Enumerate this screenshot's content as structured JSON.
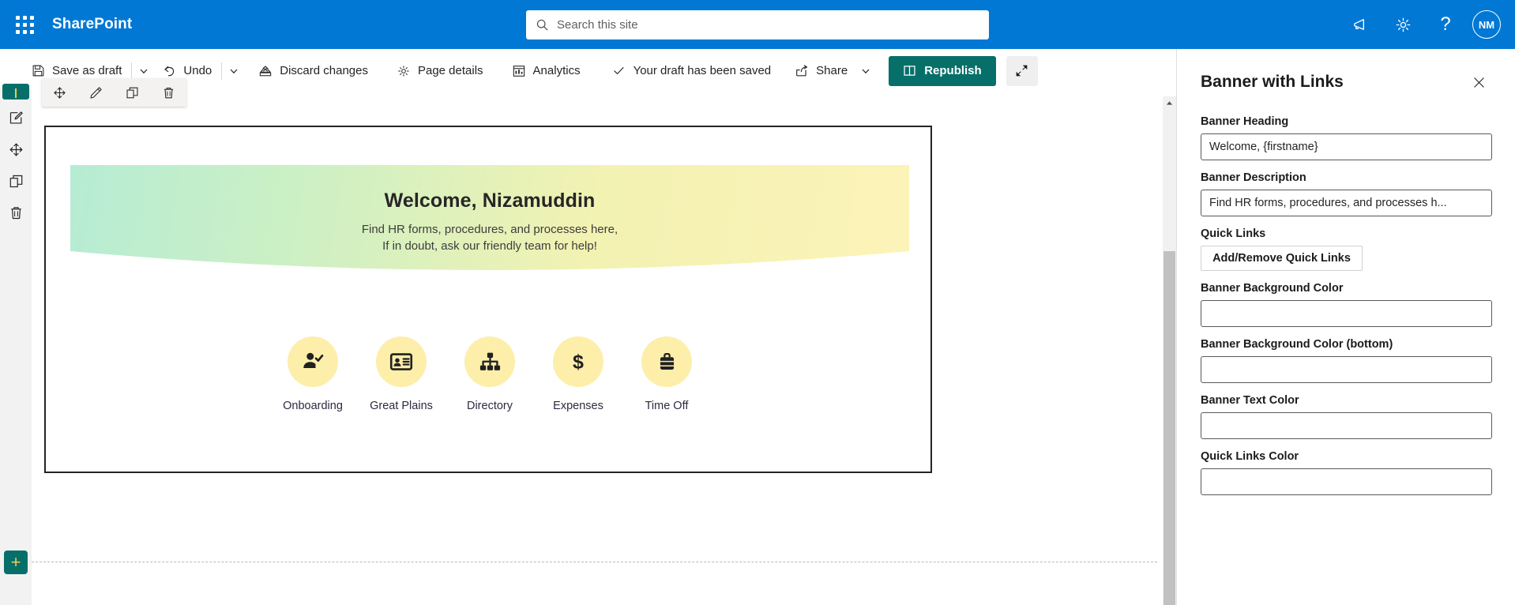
{
  "suite": {
    "brand": "SharePoint",
    "waffle_name": "app-launcher",
    "search_placeholder": "Search this site",
    "search_value": "",
    "icons": [
      {
        "name": "megaphone-icon",
        "glyph": "megaphone"
      },
      {
        "name": "gear-icon",
        "glyph": "gear"
      },
      {
        "name": "help-icon",
        "glyph": "?"
      }
    ],
    "avatar_initials": "NM"
  },
  "command_bar": {
    "save_as_draft": "Save as draft",
    "undo": "Undo",
    "discard_changes": "Discard changes",
    "page_details": "Page details",
    "analytics": "Analytics",
    "status_text": "Your draft has been saved",
    "share": "Share",
    "republish": "Republish",
    "collapse_name": "collapse-ribbon"
  },
  "left_rail": {
    "items": [
      {
        "name": "rail-edit-webpart",
        "icon": "edit-icon"
      },
      {
        "name": "rail-move-webpart",
        "icon": "move-icon"
      },
      {
        "name": "rail-duplicate-webpart",
        "icon": "duplicate-icon"
      },
      {
        "name": "rail-delete-webpart",
        "icon": "trash-icon"
      }
    ],
    "add_section_label": "+"
  },
  "webpart_toolbar": {
    "tools": [
      {
        "name": "move-webpart-button",
        "icon": "move-icon"
      },
      {
        "name": "edit-webpart-button",
        "icon": "pencil-icon"
      },
      {
        "name": "duplicate-webpart-button",
        "icon": "duplicate-icon"
      },
      {
        "name": "delete-webpart-button",
        "icon": "trash-icon"
      }
    ]
  },
  "banner": {
    "heading": "Welcome, Nizamuddin",
    "description_line1": "Find HR forms, procedures, and processes here,",
    "description_line2": "If in doubt, ask our friendly team for help!",
    "gradient_start": "#b6ecd4",
    "gradient_end": "#fdf3b8",
    "text_color": "#262626",
    "quick_link_circle_color": "#fdeeaa"
  },
  "quick_links": [
    {
      "label": "Onboarding",
      "icon": "person-check-icon"
    },
    {
      "label": "Great Plains",
      "icon": "id-card-icon"
    },
    {
      "label": "Directory",
      "icon": "org-chart-icon"
    },
    {
      "label": "Expenses",
      "icon": "dollar-sign-icon"
    },
    {
      "label": "Time Off",
      "icon": "suitcase-icon"
    }
  ],
  "property_pane": {
    "title": "Banner with Links",
    "close_name": "close-panel-button",
    "fields": [
      {
        "label": "Banner Heading",
        "value": "Welcome, {firstname}",
        "name": "banner-heading-field"
      },
      {
        "label": "Banner Description",
        "value": "Find HR forms, procedures, and processes h...",
        "name": "banner-description-field"
      }
    ],
    "quick_links_label": "Quick Links",
    "quick_links_button": "Add/Remove Quick Links",
    "color_fields": [
      {
        "label": "Banner Background Color",
        "value": "",
        "name": "banner-background-color-field"
      },
      {
        "label": "Banner Background Color (bottom)",
        "value": "",
        "name": "banner-background-color-bottom-field"
      },
      {
        "label": "Banner Text Color",
        "value": "",
        "name": "banner-text-color-field"
      },
      {
        "label": "Quick Links Color",
        "value": "",
        "name": "quick-links-color-field"
      }
    ]
  }
}
